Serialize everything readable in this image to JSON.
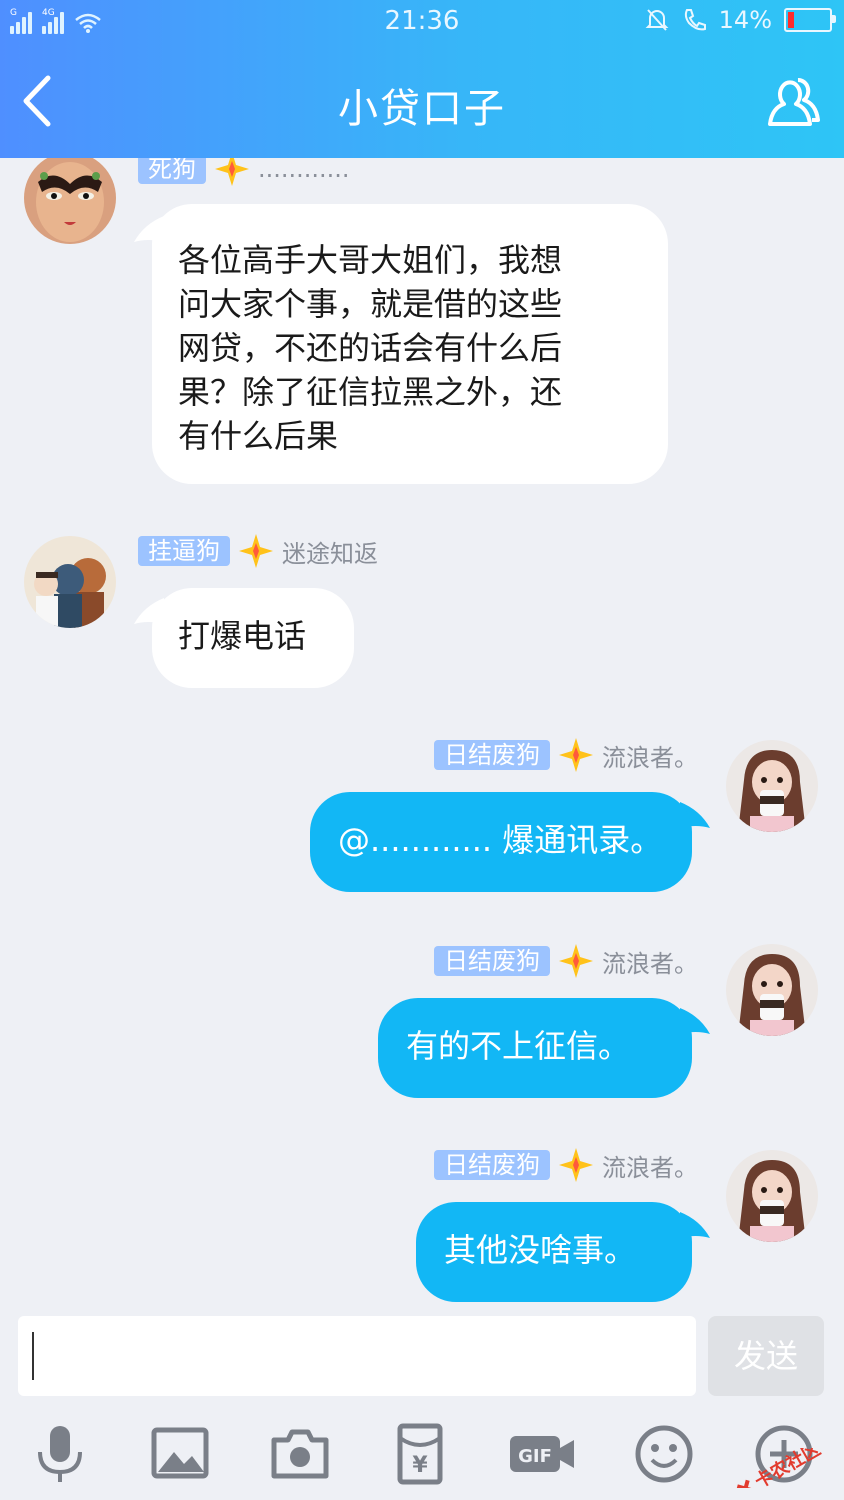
{
  "status_bar": {
    "time": "21:36",
    "network_label": "4G",
    "sim_label": "G",
    "battery_percent": "14%",
    "battery_level": 0.14,
    "battery_color": "#ff2a2a"
  },
  "header": {
    "title": "小贷口子",
    "back_icon": "chevron-left-icon",
    "members_icon": "group-members-icon"
  },
  "messages": [
    {
      "side": "in",
      "badge": "死狗",
      "nickname": "............",
      "text_lines": [
        "各位高手大哥大姐们，我想",
        "问大家个事，就是借的这些",
        "网贷，不还的话会有什么后",
        "果？除了征信拉黑之外，还",
        "有什么后果"
      ]
    },
    {
      "side": "in",
      "badge": "挂逼狗",
      "nickname": "迷途知返",
      "text_lines": [
        "打爆电话"
      ]
    },
    {
      "side": "out",
      "badge": "日结废狗",
      "nickname": "流浪者。",
      "text_lines": [
        "@............ 爆通讯录。"
      ]
    },
    {
      "side": "out",
      "badge": "日结废狗",
      "nickname": "流浪者。",
      "text_lines": [
        "有的不上征信。"
      ]
    },
    {
      "side": "out",
      "badge": "日结废狗",
      "nickname": "流浪者。",
      "text_lines": [
        "其他没啥事。"
      ]
    }
  ],
  "input": {
    "value": "",
    "send_label": "发送"
  },
  "toolbar_icons": [
    "microphone-icon",
    "image-icon",
    "camera-icon",
    "red-packet-icon",
    "gif-icon",
    "emoji-icon",
    "plus-icon"
  ],
  "watermark_text": "卡农社区",
  "colors": {
    "header_start": "#4f8fff",
    "header_end": "#2ec5f6",
    "bubble_out": "#12b7f5",
    "bubble_in": "#ffffff",
    "badge": "#9cc3ff",
    "background": "#eef0f5"
  }
}
